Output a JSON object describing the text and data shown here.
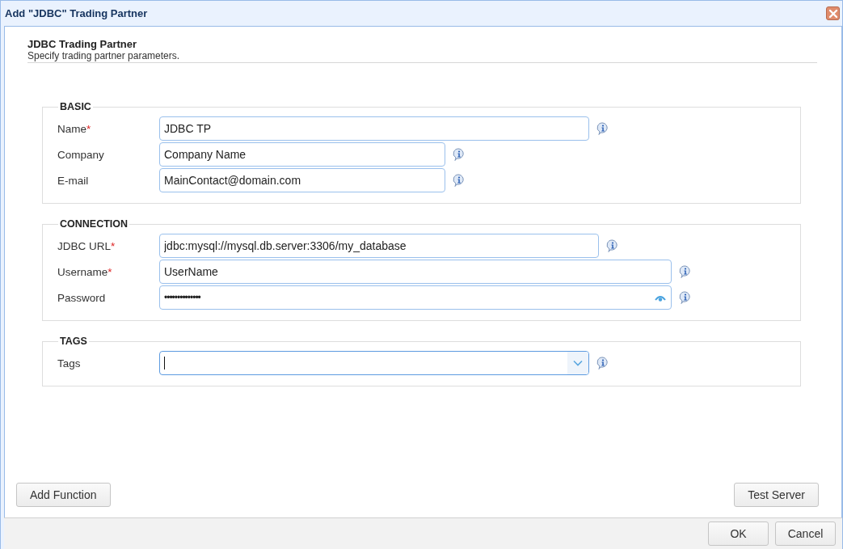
{
  "window": {
    "title": "Add \"JDBC\" Trading Partner"
  },
  "header": {
    "title": "JDBC Trading Partner",
    "subtitle": "Specify trading partner parameters."
  },
  "sections": [
    {
      "legend": "BASIC",
      "fields": [
        {
          "kind": "text",
          "label": "Name",
          "required_mark": "*",
          "value": "JDBC TP"
        },
        {
          "kind": "text",
          "label": "Company",
          "value": "Company Name"
        },
        {
          "kind": "text",
          "label": "E-mail",
          "value": "MainContact@domain.com"
        }
      ]
    },
    {
      "legend": "CONNECTION",
      "fields": [
        {
          "kind": "text",
          "label": "JDBC URL",
          "required_mark": "*",
          "value": "jdbc:mysql://mysql.db.server:3306/my_database"
        },
        {
          "kind": "text",
          "label": "Username",
          "required_mark": "*",
          "value": "UserName"
        },
        {
          "kind": "password",
          "label": "Password",
          "value": "••••••••••••••"
        }
      ]
    },
    {
      "legend": "TAGS",
      "fields": [
        {
          "kind": "combo",
          "label": "Tags"
        }
      ]
    }
  ],
  "actions": [
    "Add Function",
    "Test Server"
  ],
  "footer_buttons": [
    "OK",
    "Cancel"
  ]
}
